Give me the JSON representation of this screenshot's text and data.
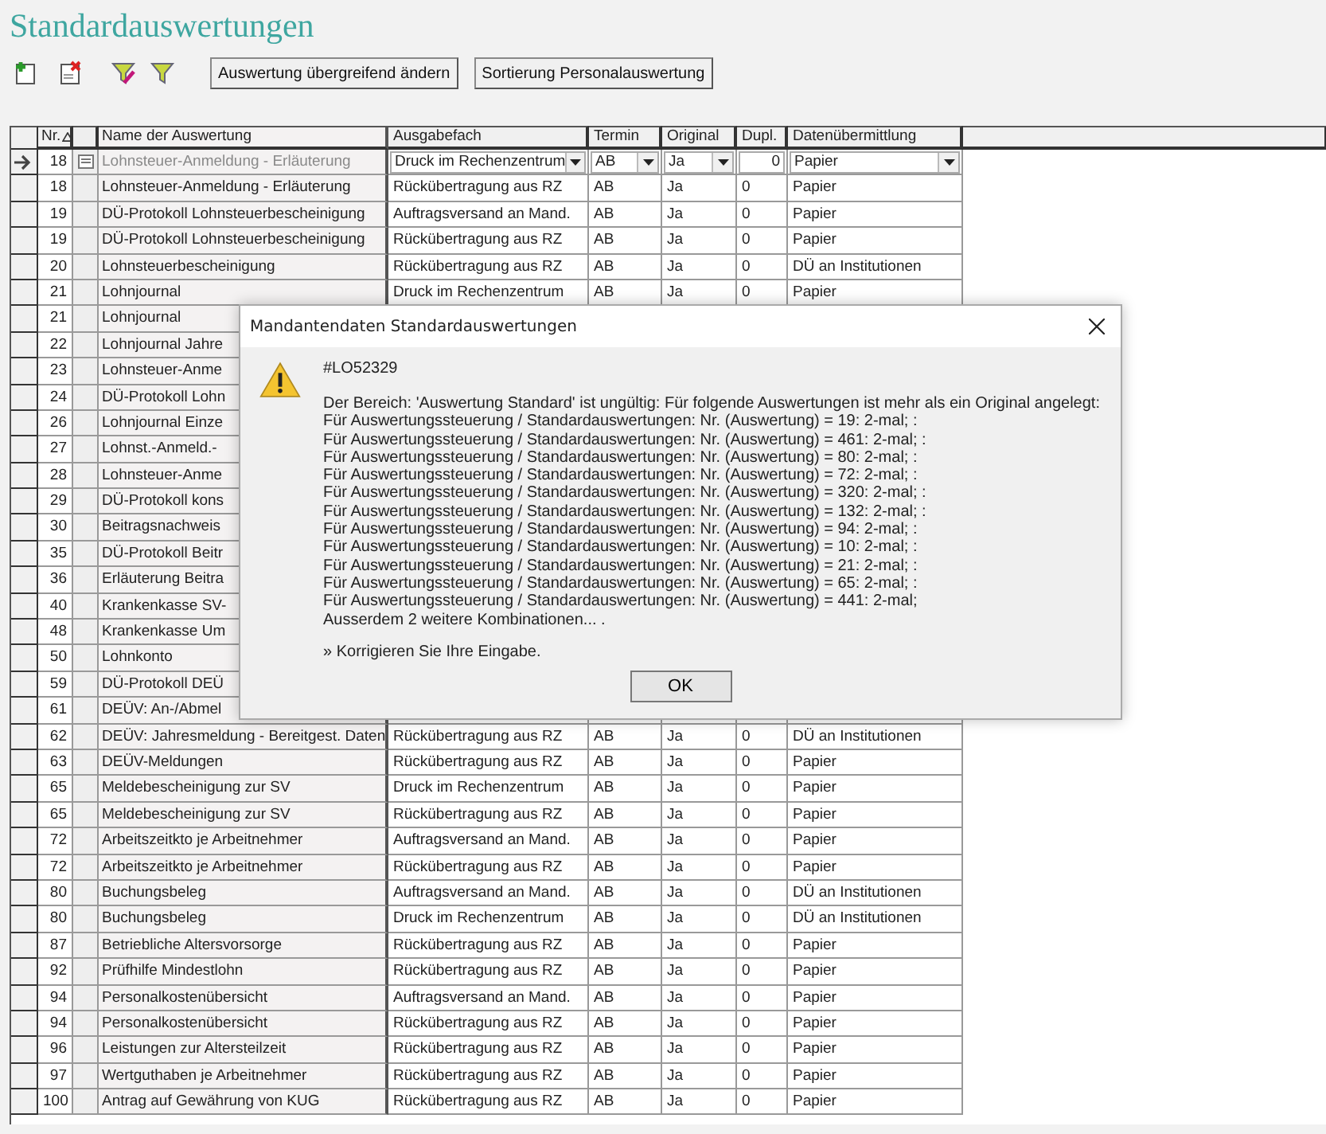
{
  "title": "Standardauswertungen",
  "toolbar": {
    "buttons": [
      "Auswertung übergreifend ändern",
      "Sortierung Personalauswertung"
    ]
  },
  "table": {
    "columns": [
      {
        "label": "Nr.",
        "sorted": true
      },
      {
        "label": "Name der Auswertung"
      },
      {
        "label": "Ausgabefach"
      },
      {
        "label": "Termin"
      },
      {
        "label": "Original"
      },
      {
        "label": "Dupl."
      },
      {
        "label": "Datenübermittlung"
      }
    ],
    "rows": [
      {
        "selected": true,
        "nr": "18",
        "name": "Lohnsteuer-Anmeldung - Erläuterung",
        "ausgabefach": "Druck im Rechenzentrum",
        "termin": "AB",
        "original": "Ja",
        "dupl": "0",
        "daten": "Papier"
      },
      {
        "selected": false,
        "nr": "18",
        "name": "Lohnsteuer-Anmeldung - Erläuterung",
        "ausgabefach": "Rückübertragung aus RZ",
        "termin": "AB",
        "original": "Ja",
        "dupl": "0",
        "daten": "Papier"
      },
      {
        "selected": false,
        "nr": "19",
        "name": "DÜ-Protokoll Lohnsteuerbescheinigung",
        "ausgabefach": "Auftragsversand an Mand.",
        "termin": "AB",
        "original": "Ja",
        "dupl": "0",
        "daten": "Papier"
      },
      {
        "selected": false,
        "nr": "19",
        "name": "DÜ-Protokoll Lohnsteuerbescheinigung",
        "ausgabefach": "Rückübertragung aus RZ",
        "termin": "AB",
        "original": "Ja",
        "dupl": "0",
        "daten": "Papier"
      },
      {
        "selected": false,
        "nr": "20",
        "name": "Lohnsteuerbescheinigung",
        "ausgabefach": "Rückübertragung aus RZ",
        "termin": "AB",
        "original": "Ja",
        "dupl": "0",
        "daten": "DÜ an Institutionen"
      },
      {
        "selected": false,
        "nr": "21",
        "name": "Lohnjournal",
        "ausgabefach": "Druck im Rechenzentrum",
        "termin": "AB",
        "original": "Ja",
        "dupl": "0",
        "daten": "Papier"
      },
      {
        "selected": false,
        "nr": "21",
        "name": "Lohnjournal"
      },
      {
        "selected": false,
        "nr": "22",
        "name": "Lohnjournal Jahre"
      },
      {
        "selected": false,
        "nr": "23",
        "name": "Lohnsteuer-Anme"
      },
      {
        "selected": false,
        "nr": "24",
        "name": "DÜ-Protokoll Lohn"
      },
      {
        "selected": false,
        "nr": "26",
        "name": "Lohnjournal Einze"
      },
      {
        "selected": false,
        "nr": "27",
        "name": "Lohnst.-Anmeld.-"
      },
      {
        "selected": false,
        "nr": "28",
        "name": "Lohnsteuer-Anme"
      },
      {
        "selected": false,
        "nr": "29",
        "name": "DÜ-Protokoll kons"
      },
      {
        "selected": false,
        "nr": "30",
        "name": "Beitragsnachweis"
      },
      {
        "selected": false,
        "nr": "35",
        "name": "DÜ-Protokoll Beitr"
      },
      {
        "selected": false,
        "nr": "36",
        "name": "Erläuterung Beitra"
      },
      {
        "selected": false,
        "nr": "40",
        "name": "Krankenkasse SV-"
      },
      {
        "selected": false,
        "nr": "48",
        "name": "Krankenkasse Um"
      },
      {
        "selected": false,
        "nr": "50",
        "name": "Lohnkonto"
      },
      {
        "selected": false,
        "nr": "59",
        "name": "DÜ-Protokoll DEÜ"
      },
      {
        "selected": false,
        "nr": "61",
        "name": "DEÜV: An-/Abmel"
      },
      {
        "selected": false,
        "nr": "62",
        "name": "DEÜV: Jahresmeldung - Bereitgest. Daten",
        "ausgabefach": "Rückübertragung aus RZ",
        "termin": "AB",
        "original": "Ja",
        "dupl": "0",
        "daten": "DÜ an Institutionen"
      },
      {
        "selected": false,
        "nr": "63",
        "name": "DEÜV-Meldungen",
        "ausgabefach": "Rückübertragung aus RZ",
        "termin": "AB",
        "original": "Ja",
        "dupl": "0",
        "daten": "Papier"
      },
      {
        "selected": false,
        "nr": "65",
        "name": "Meldebescheinigung zur SV",
        "ausgabefach": "Druck im Rechenzentrum",
        "termin": "AB",
        "original": "Ja",
        "dupl": "0",
        "daten": "Papier"
      },
      {
        "selected": false,
        "nr": "65",
        "name": "Meldebescheinigung zur SV",
        "ausgabefach": "Rückübertragung aus RZ",
        "termin": "AB",
        "original": "Ja",
        "dupl": "0",
        "daten": "Papier"
      },
      {
        "selected": false,
        "nr": "72",
        "name": "Arbeitszeitkto je Arbeitnehmer",
        "ausgabefach": "Auftragsversand an Mand.",
        "termin": "AB",
        "original": "Ja",
        "dupl": "0",
        "daten": "Papier"
      },
      {
        "selected": false,
        "nr": "72",
        "name": "Arbeitszeitkto je Arbeitnehmer",
        "ausgabefach": "Rückübertragung aus RZ",
        "termin": "AB",
        "original": "Ja",
        "dupl": "0",
        "daten": "Papier"
      },
      {
        "selected": false,
        "nr": "80",
        "name": "Buchungsbeleg",
        "ausgabefach": "Auftragsversand an Mand.",
        "termin": "AB",
        "original": "Ja",
        "dupl": "0",
        "daten": "DÜ an Institutionen"
      },
      {
        "selected": false,
        "nr": "80",
        "name": "Buchungsbeleg",
        "ausgabefach": "Druck im Rechenzentrum",
        "termin": "AB",
        "original": "Ja",
        "dupl": "0",
        "daten": "DÜ an Institutionen"
      },
      {
        "selected": false,
        "nr": "87",
        "name": "Betriebliche Altersvorsorge",
        "ausgabefach": "Rückübertragung aus RZ",
        "termin": "AB",
        "original": "Ja",
        "dupl": "0",
        "daten": "Papier"
      },
      {
        "selected": false,
        "nr": "92",
        "name": "Prüfhilfe Mindestlohn",
        "ausgabefach": "Rückübertragung aus RZ",
        "termin": "AB",
        "original": "Ja",
        "dupl": "0",
        "daten": "Papier"
      },
      {
        "selected": false,
        "nr": "94",
        "name": "Personalkostenübersicht",
        "ausgabefach": "Auftragsversand an Mand.",
        "termin": "AB",
        "original": "Ja",
        "dupl": "0",
        "daten": "Papier"
      },
      {
        "selected": false,
        "nr": "94",
        "name": "Personalkostenübersicht",
        "ausgabefach": "Rückübertragung aus RZ",
        "termin": "AB",
        "original": "Ja",
        "dupl": "0",
        "daten": "Papier"
      },
      {
        "selected": false,
        "nr": "96",
        "name": "Leistungen zur Altersteilzeit",
        "ausgabefach": "Rückübertragung aus RZ",
        "termin": "AB",
        "original": "Ja",
        "dupl": "0",
        "daten": "Papier"
      },
      {
        "selected": false,
        "nr": "97",
        "name": "Wertguthaben je Arbeitnehmer",
        "ausgabefach": "Rückübertragung aus RZ",
        "termin": "AB",
        "original": "Ja",
        "dupl": "0",
        "daten": "Papier"
      },
      {
        "selected": false,
        "nr": "100",
        "name": "Antrag auf Gewährung von KUG",
        "ausgabefach": "Rückübertragung aus RZ",
        "termin": "AB",
        "original": "Ja",
        "dupl": "0",
        "daten": "Papier"
      }
    ]
  },
  "dialog": {
    "title": "Mandantendaten Standardauswertungen",
    "code": "#LO52329",
    "lines": [
      "Der Bereich: 'Auswertung Standard' ist ungültig: Für folgende Auswertungen ist mehr als ein Original angelegt:",
      "Für Auswertungssteuerung / Standardauswertungen: Nr. (Auswertung) = 19: 2-mal; :",
      "Für Auswertungssteuerung / Standardauswertungen: Nr. (Auswertung) = 461: 2-mal; :",
      "Für Auswertungssteuerung / Standardauswertungen: Nr. (Auswertung) = 80: 2-mal; :",
      "Für Auswertungssteuerung / Standardauswertungen: Nr. (Auswertung) = 72: 2-mal; :",
      "Für Auswertungssteuerung / Standardauswertungen: Nr. (Auswertung) = 320: 2-mal; :",
      "Für Auswertungssteuerung / Standardauswertungen: Nr. (Auswertung) = 132: 2-mal; :",
      "Für Auswertungssteuerung / Standardauswertungen: Nr. (Auswertung) = 94: 2-mal; :",
      "Für Auswertungssteuerung / Standardauswertungen: Nr. (Auswertung) = 10: 2-mal; :",
      "Für Auswertungssteuerung / Standardauswertungen: Nr. (Auswertung) = 21: 2-mal; :",
      "Für Auswertungssteuerung / Standardauswertungen: Nr. (Auswertung) = 65: 2-mal; :",
      "Für Auswertungssteuerung / Standardauswertungen: Nr. (Auswertung) = 441: 2-mal;",
      "Ausserdem 2 weitere Kombinationen... ."
    ],
    "hint": "» Korrigieren Sie Ihre Eingabe.",
    "button": "OK"
  }
}
